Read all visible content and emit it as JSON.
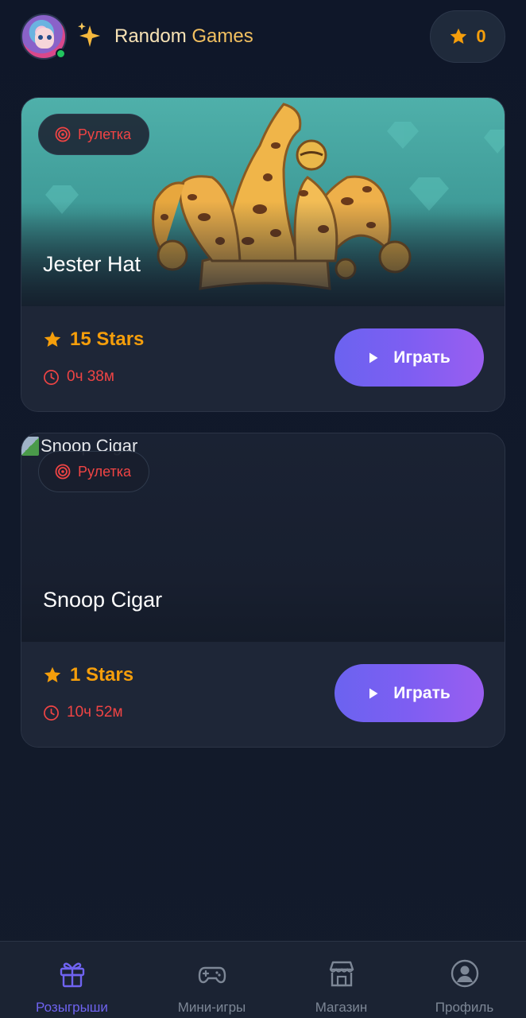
{
  "header": {
    "brand_word1": "Random",
    "brand_word2": "Games",
    "balance": "0",
    "avatar_icon": "user-avatar",
    "brand_icon": "sparkles-icon",
    "balance_icon": "star-icon"
  },
  "colors": {
    "background": "#111827",
    "card": "#1c2435",
    "accent_gold": "#f59e0b",
    "accent_red": "#ef4444",
    "accent_purple": "#7e5ef2",
    "online": "#22c55e"
  },
  "giveaways": [
    {
      "tag": "Рулетка",
      "title": "Jester Hat",
      "prize": "15 Stars",
      "timer": "0ч 38м",
      "play_label": "Играть",
      "image_alt": ""
    },
    {
      "tag": "Рулетка",
      "title": "Snoop Cigar",
      "prize": "1 Stars",
      "timer": "10ч 52м",
      "play_label": "Играть",
      "image_alt": "Snoop Cigar"
    }
  ],
  "nav": {
    "items": [
      {
        "label": "Розыгрыши",
        "icon": "gift-icon",
        "active": true
      },
      {
        "label": "Мини-игры",
        "icon": "gamepad-icon",
        "active": false
      },
      {
        "label": "Магазин",
        "icon": "store-icon",
        "active": false
      },
      {
        "label": "Профиль",
        "icon": "user-circle-icon",
        "active": false
      }
    ]
  }
}
